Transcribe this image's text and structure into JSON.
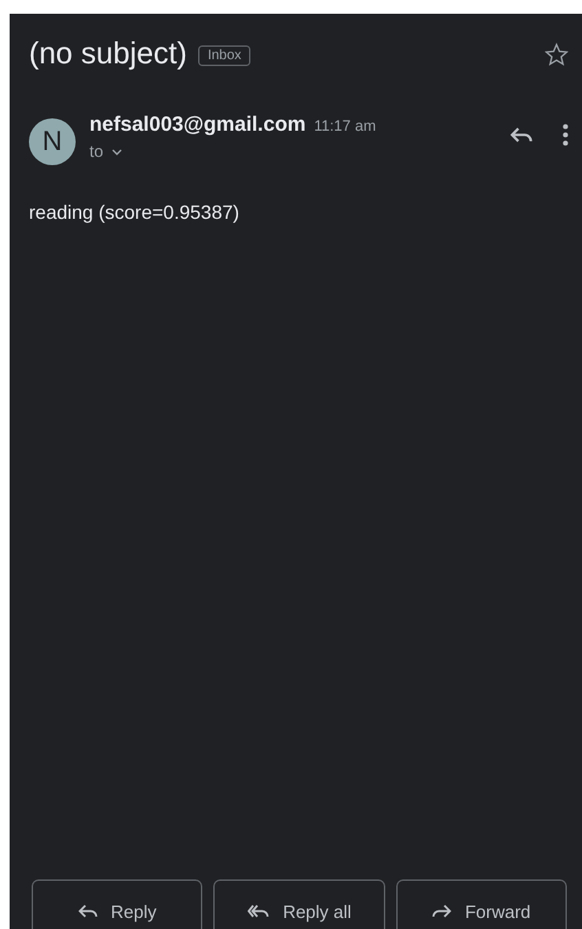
{
  "subject": "(no subject)",
  "label": "Inbox",
  "starred": false,
  "sender": {
    "initial": "N",
    "email": "nefsal003@gmail.com",
    "time": "11:17 am",
    "to": "to"
  },
  "body": "reading (score=0.95387)",
  "buttons": [
    {
      "kind": "reply",
      "label": "Reply"
    },
    {
      "kind": "reply_all",
      "label": "Reply all"
    },
    {
      "kind": "forward",
      "label": "Forward"
    }
  ]
}
